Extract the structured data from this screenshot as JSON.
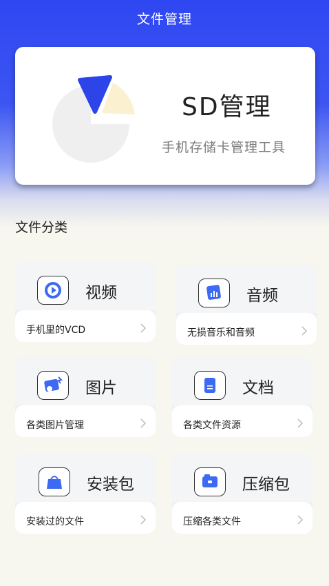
{
  "header": {
    "title": "文件管理"
  },
  "hero": {
    "title": "SD管理",
    "subtitle": "手机存储卡管理工具"
  },
  "section": {
    "title": "文件分类"
  },
  "categories": [
    {
      "label": "视频",
      "desc": "手机里的VCD",
      "icon": "video-icon"
    },
    {
      "label": "音频",
      "desc": "无损音乐和音频",
      "icon": "audio-icon"
    },
    {
      "label": "图片",
      "desc": "各类图片管理",
      "icon": "image-icon"
    },
    {
      "label": "文档",
      "desc": "各类文件资源",
      "icon": "document-icon"
    },
    {
      "label": "安装包",
      "desc": "安装过的文件",
      "icon": "package-icon"
    },
    {
      "label": "压缩包",
      "desc": "压缩各类文件",
      "icon": "archive-icon"
    }
  ],
  "colors": {
    "accent": "#2f47f2",
    "background": "#f8f7ef"
  }
}
